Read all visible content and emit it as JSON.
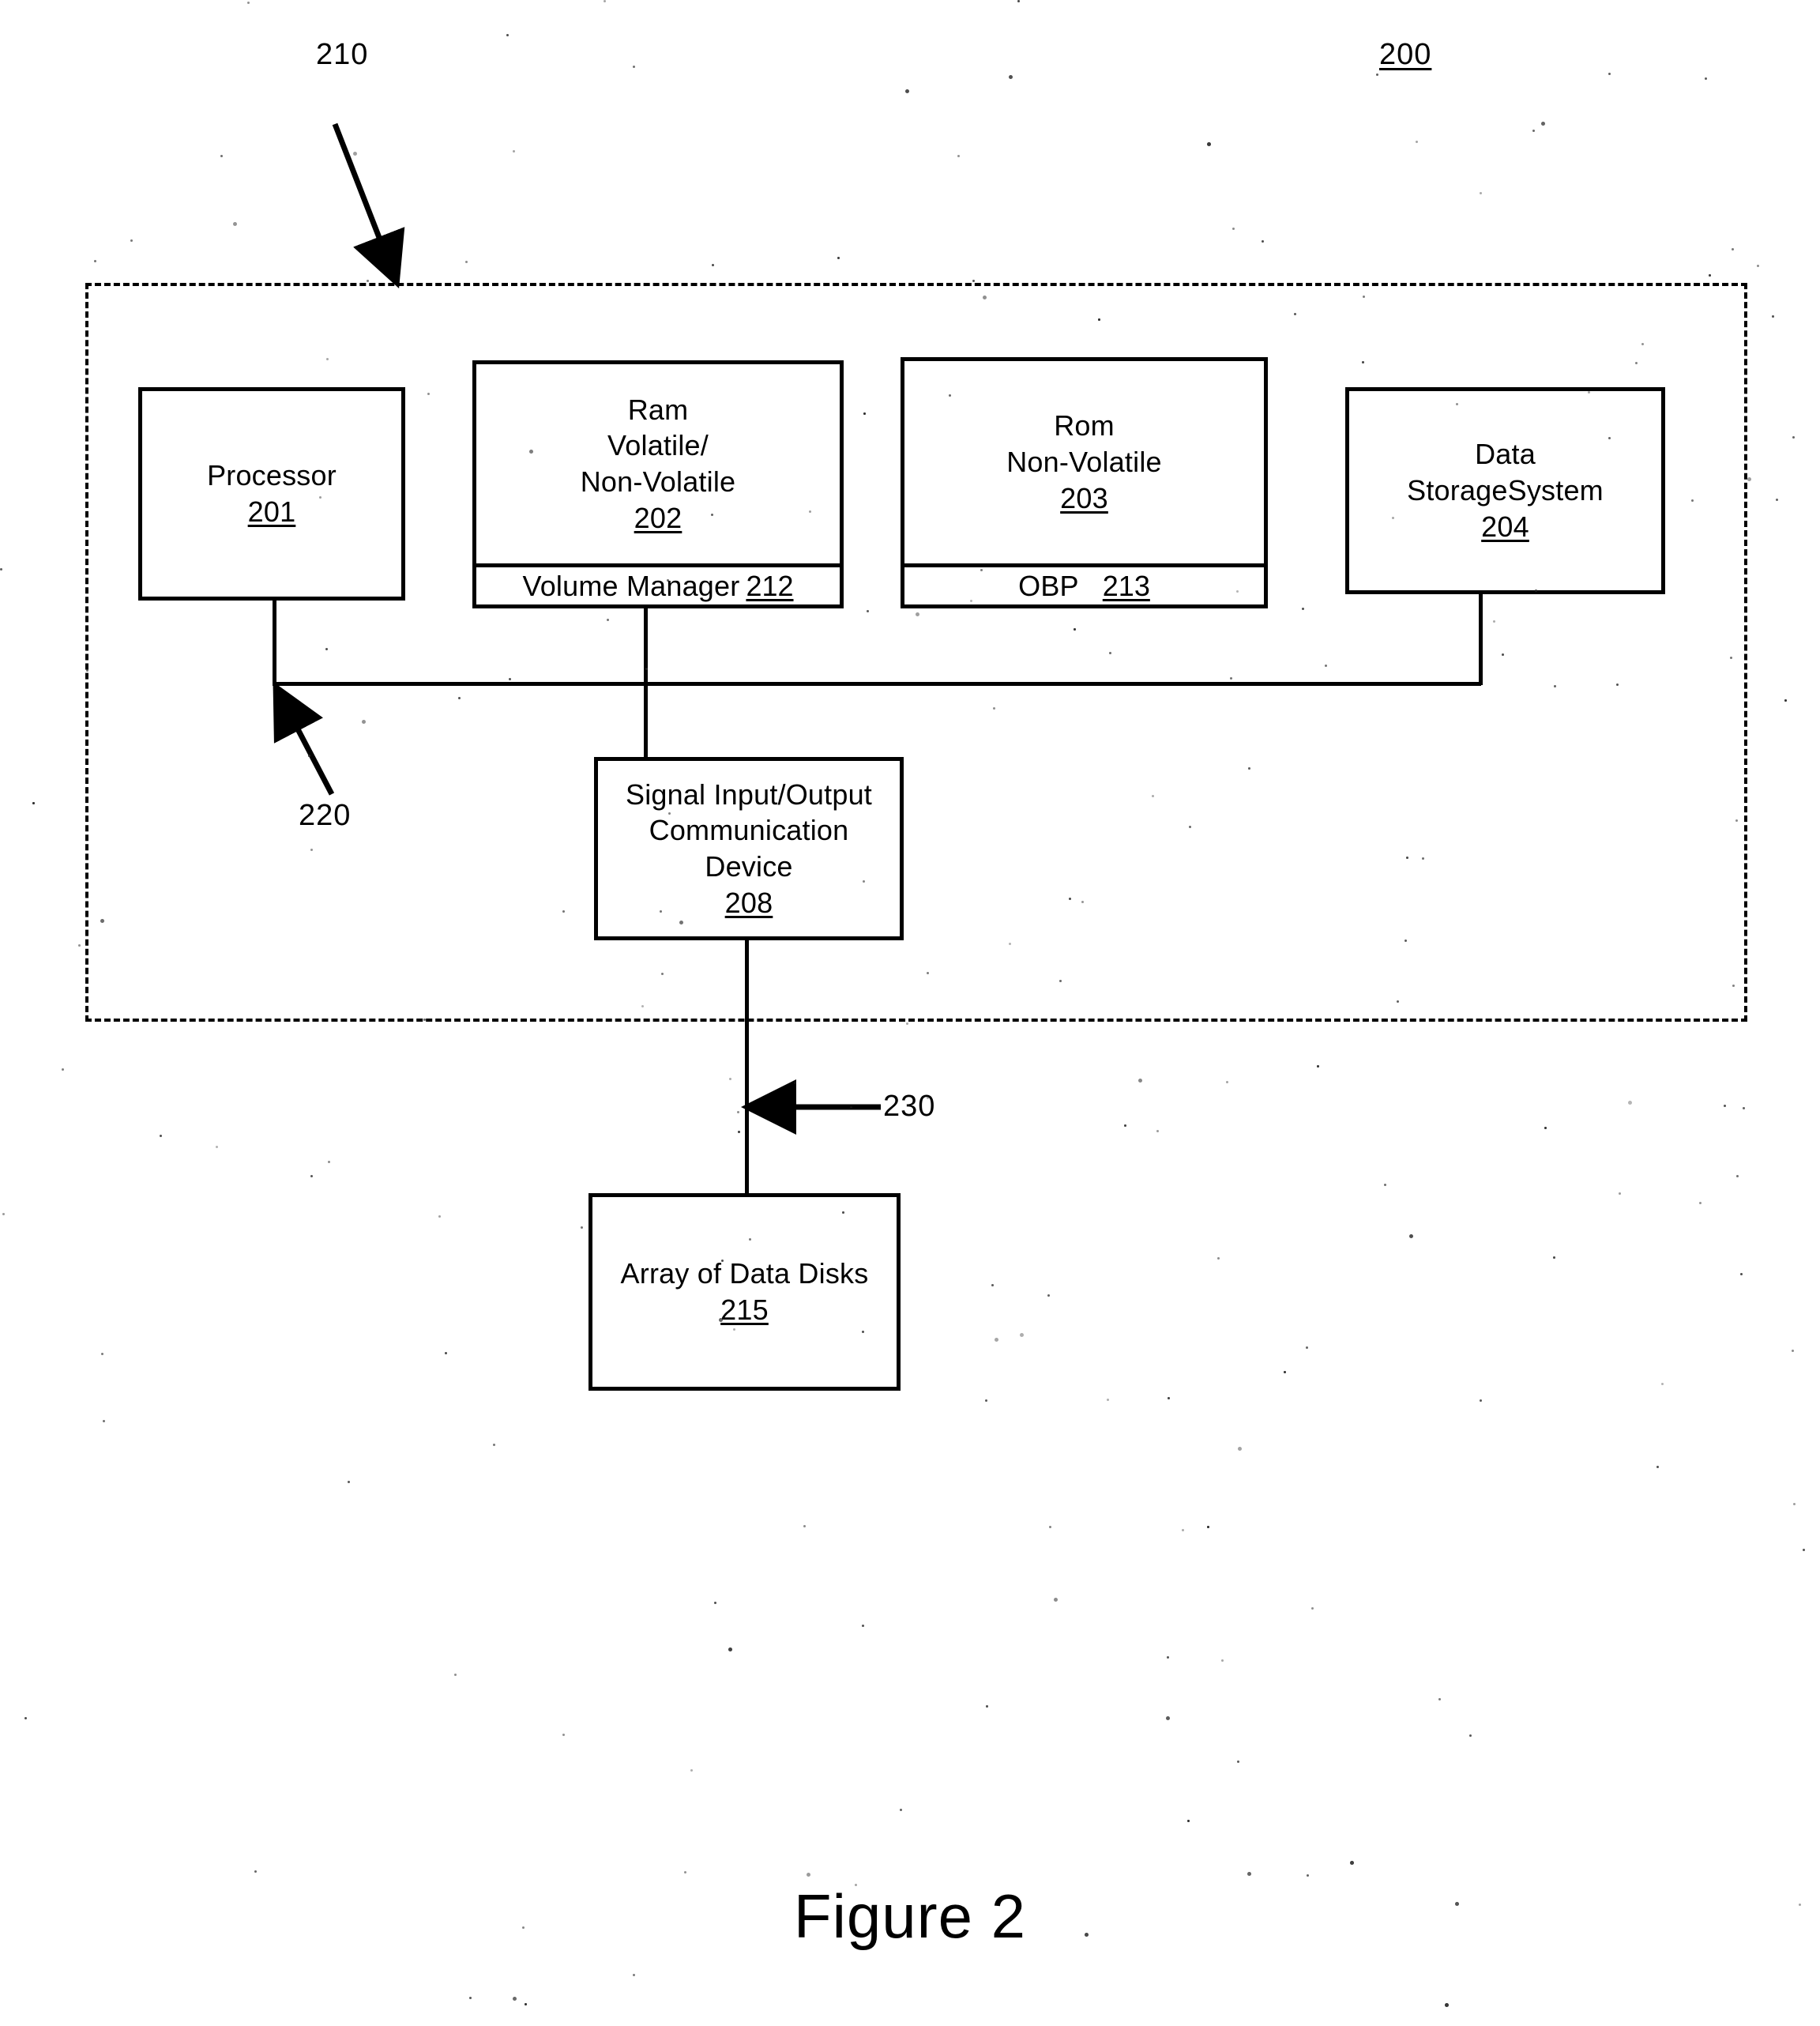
{
  "figure": {
    "caption": "Figure 2",
    "system_ref": "200",
    "boundary_ref": "210",
    "bus_ref": "220",
    "link_ref": "230"
  },
  "boxes": {
    "processor": {
      "lines": [
        "Processor"
      ],
      "ref": "201"
    },
    "ram": {
      "lines": [
        "Ram",
        "Volatile/",
        "Non-Volatile"
      ],
      "ref": "202",
      "sub_label": "Volume Manager",
      "sub_ref": "212"
    },
    "rom": {
      "lines": [
        "Rom",
        "Non-Volatile"
      ],
      "ref": "203",
      "sub_label": "OBP",
      "sub_ref": "213"
    },
    "data_storage": {
      "lines": [
        "Data",
        "StorageSystem"
      ],
      "ref": "204"
    },
    "signal_io": {
      "lines": [
        "Signal Input/Output",
        "Communication",
        "Device"
      ],
      "ref": "208"
    },
    "disk_array": {
      "lines": [
        "Array of Data Disks"
      ],
      "ref": "215"
    }
  },
  "colors": {
    "ink": "#000000",
    "paper": "#ffffff"
  }
}
